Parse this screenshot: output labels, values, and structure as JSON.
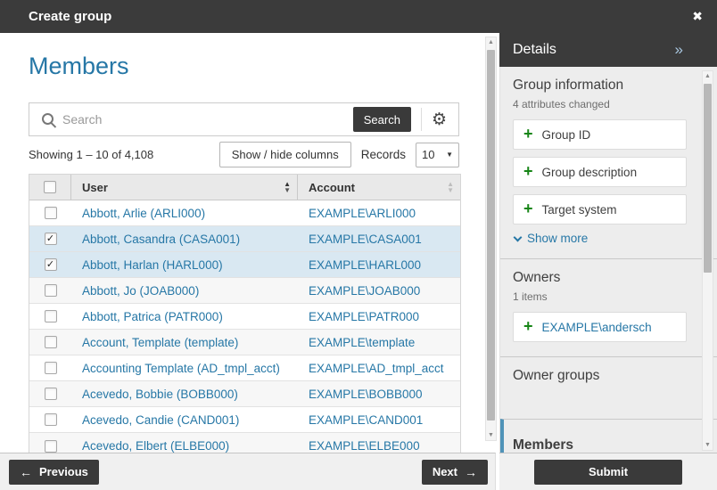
{
  "titlebar": {
    "title": "Create group",
    "close_icon": "✖"
  },
  "main": {
    "heading": "Members",
    "search": {
      "placeholder": "Search",
      "button_label": "Search"
    },
    "toolbar": {
      "showing": "Showing 1 – 10 of 4,108",
      "show_hide_label": "Show / hide columns",
      "records_label": "Records",
      "records_value": "10"
    },
    "table": {
      "columns": [
        {
          "label": "User",
          "sort": "asc"
        },
        {
          "label": "Account",
          "sort": "none"
        }
      ],
      "rows": [
        {
          "user": "Abbott, Arlie (ARLI000)",
          "account": "EXAMPLE\\ARLI000",
          "checked": false,
          "selected": false
        },
        {
          "user": "Abbott, Casandra (CASA001)",
          "account": "EXAMPLE\\CASA001",
          "checked": true,
          "selected": true
        },
        {
          "user": "Abbott, Harlan (HARL000)",
          "account": "EXAMPLE\\HARL000",
          "checked": true,
          "selected": true
        },
        {
          "user": "Abbott, Jo (JOAB000)",
          "account": "EXAMPLE\\JOAB000",
          "checked": false,
          "selected": false
        },
        {
          "user": "Abbott, Patrica (PATR000)",
          "account": "EXAMPLE\\PATR000",
          "checked": false,
          "selected": false
        },
        {
          "user": "Account, Template (template)",
          "account": "EXAMPLE\\template",
          "checked": false,
          "selected": false
        },
        {
          "user": "Accounting Template (AD_tmpl_acct)",
          "account": "EXAMPLE\\AD_tmpl_acct",
          "checked": false,
          "selected": false
        },
        {
          "user": "Acevedo, Bobbie (BOBB000)",
          "account": "EXAMPLE\\BOBB000",
          "checked": false,
          "selected": false
        },
        {
          "user": "Acevedo, Candie (CAND001)",
          "account": "EXAMPLE\\CAND001",
          "checked": false,
          "selected": false
        },
        {
          "user": "Acevedo, Elbert (ELBE000)",
          "account": "EXAMPLE\\ELBE000",
          "checked": false,
          "selected": false
        }
      ]
    },
    "footer": {
      "previous_label": "Previous",
      "next_label": "Next",
      "prev_arrow": "←",
      "next_arrow": "→"
    }
  },
  "details": {
    "title": "Details",
    "collapse_icon": "»",
    "sections": [
      {
        "heading": "Group information",
        "subtext": "4 attributes changed",
        "items": [
          {
            "label": "Group ID",
            "link": false
          },
          {
            "label": "Group description",
            "link": false
          },
          {
            "label": "Target system",
            "link": false
          }
        ],
        "show_more_label": "Show more"
      },
      {
        "heading": "Owners",
        "subtext": "1 items",
        "items": [
          {
            "label": "EXAMPLE\\andersch",
            "link": true
          }
        ]
      },
      {
        "heading": "Owner groups",
        "items": []
      },
      {
        "heading": "Members",
        "items": [],
        "active": true
      }
    ],
    "submit_label": "Submit"
  },
  "colors": {
    "dark_bar": "#3b3b3b",
    "accent_blue": "#2677a6",
    "selected_row": "#d9e8f2",
    "panel_bg": "#ededed",
    "green_plus": "#168516",
    "active_section_accent": "#4f93b8"
  }
}
